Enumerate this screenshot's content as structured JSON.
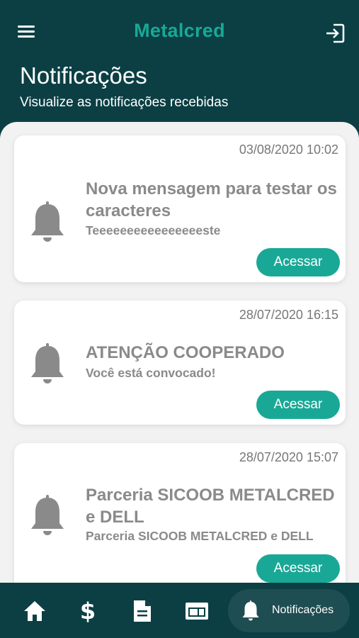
{
  "app": {
    "brand": "Metalcred"
  },
  "page": {
    "title": "Notificações",
    "subtitle": "Visualize as notificações recebidas"
  },
  "notifications": [
    {
      "date": "03/08/2020 10:02",
      "title": "Nova mensagem para testar os caracteres",
      "body": "Teeeeeeeeeeeeeeeeste",
      "action_label": "Acessar"
    },
    {
      "date": "28/07/2020 16:15",
      "title": "ATENÇÃO COOPERADO",
      "body": "Você está convocado!",
      "action_label": "Acessar"
    },
    {
      "date": "28/07/2020 15:07",
      "title": "Parceria SICOOB METALCRED e DELL",
      "body": "Parceria SICOOB METALCRED e DELL",
      "action_label": "Acessar"
    }
  ],
  "bottom_nav": {
    "items": [
      {
        "icon": "home-icon"
      },
      {
        "icon": "dollar-icon",
        "glyph": "$"
      },
      {
        "icon": "document-icon"
      },
      {
        "icon": "card-icon"
      },
      {
        "icon": "bell-icon",
        "label": "Notificações",
        "active": true
      }
    ]
  },
  "colors": {
    "header_bg": "#0b3f44",
    "accent": "#1aa896",
    "content_bg": "#f2f2f2",
    "muted_text": "#8a8a8a"
  }
}
